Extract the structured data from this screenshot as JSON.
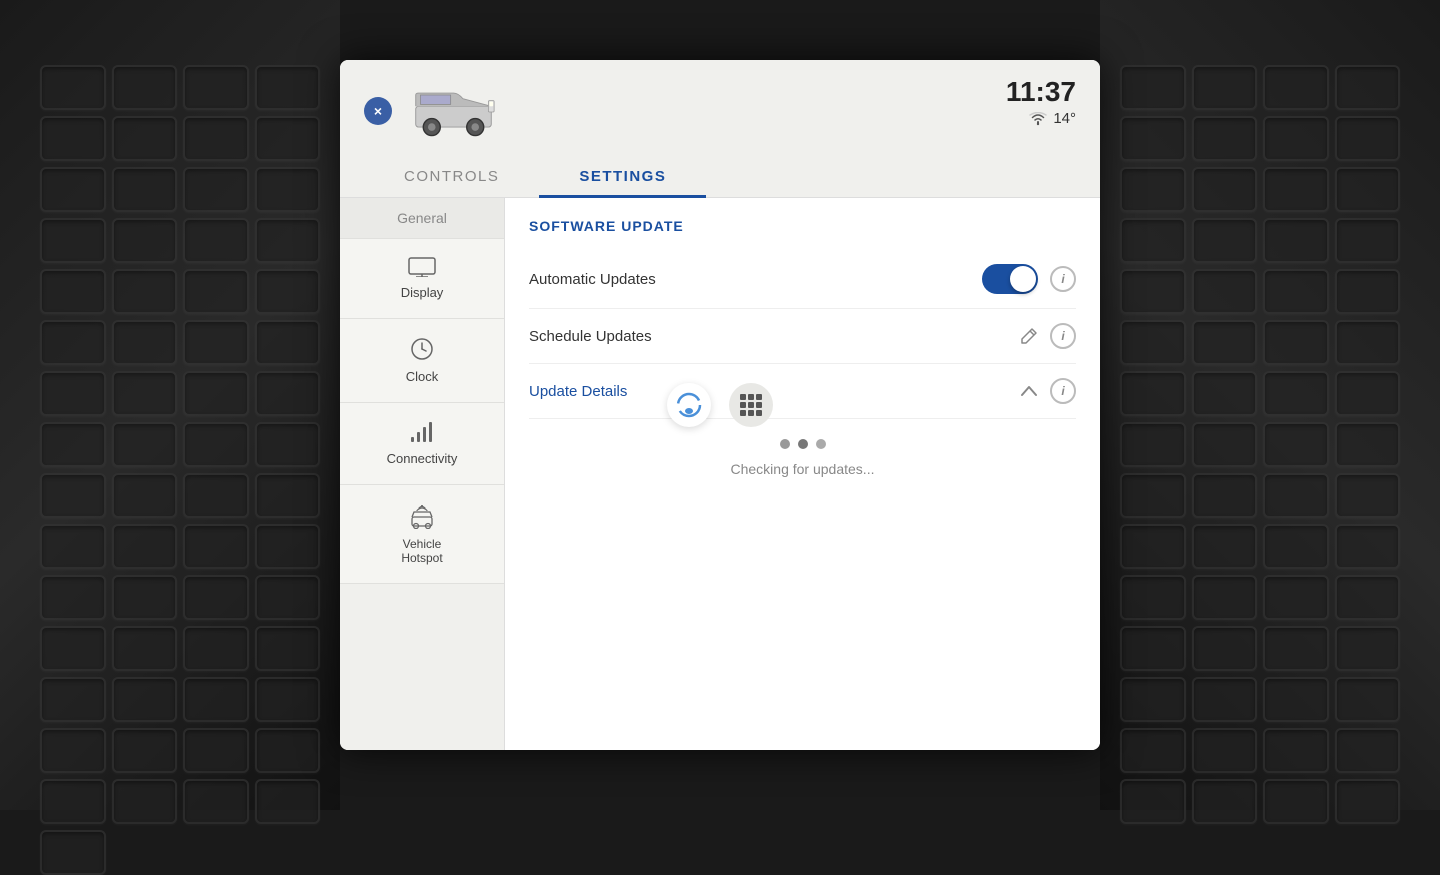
{
  "header": {
    "time": "11:37",
    "temperature": "14°",
    "close_label": "×"
  },
  "tabs": [
    {
      "id": "controls",
      "label": "CONTROLS",
      "active": false
    },
    {
      "id": "settings",
      "label": "SETTINGS",
      "active": true
    }
  ],
  "sidebar": {
    "items": [
      {
        "id": "general",
        "label": "General",
        "icon": ""
      },
      {
        "id": "display",
        "label": "Display",
        "icon": "▭"
      },
      {
        "id": "clock",
        "label": "Clock",
        "icon": "🕐"
      },
      {
        "id": "connectivity",
        "label": "Connectivity",
        "icon": "📶"
      },
      {
        "id": "vehicle-hotspot",
        "label": "Vehicle Hotspot",
        "icon": "📡"
      }
    ]
  },
  "settings": {
    "section_title": "SOFTWARE UPDATE",
    "rows": [
      {
        "id": "automatic-updates",
        "label": "Automatic Updates",
        "type": "toggle",
        "value": true,
        "has_info": true
      },
      {
        "id": "schedule-updates",
        "label": "Schedule Updates",
        "type": "edit",
        "has_info": true
      },
      {
        "id": "update-details",
        "label": "Update Details",
        "type": "chevron",
        "blue_label": true,
        "expanded": true,
        "has_info": true
      }
    ],
    "update_status": "Checking for updates..."
  },
  "icons": {
    "close": "✕",
    "info": "i",
    "edit": "✏",
    "chevron_up": "∧",
    "wifi": "📶"
  }
}
